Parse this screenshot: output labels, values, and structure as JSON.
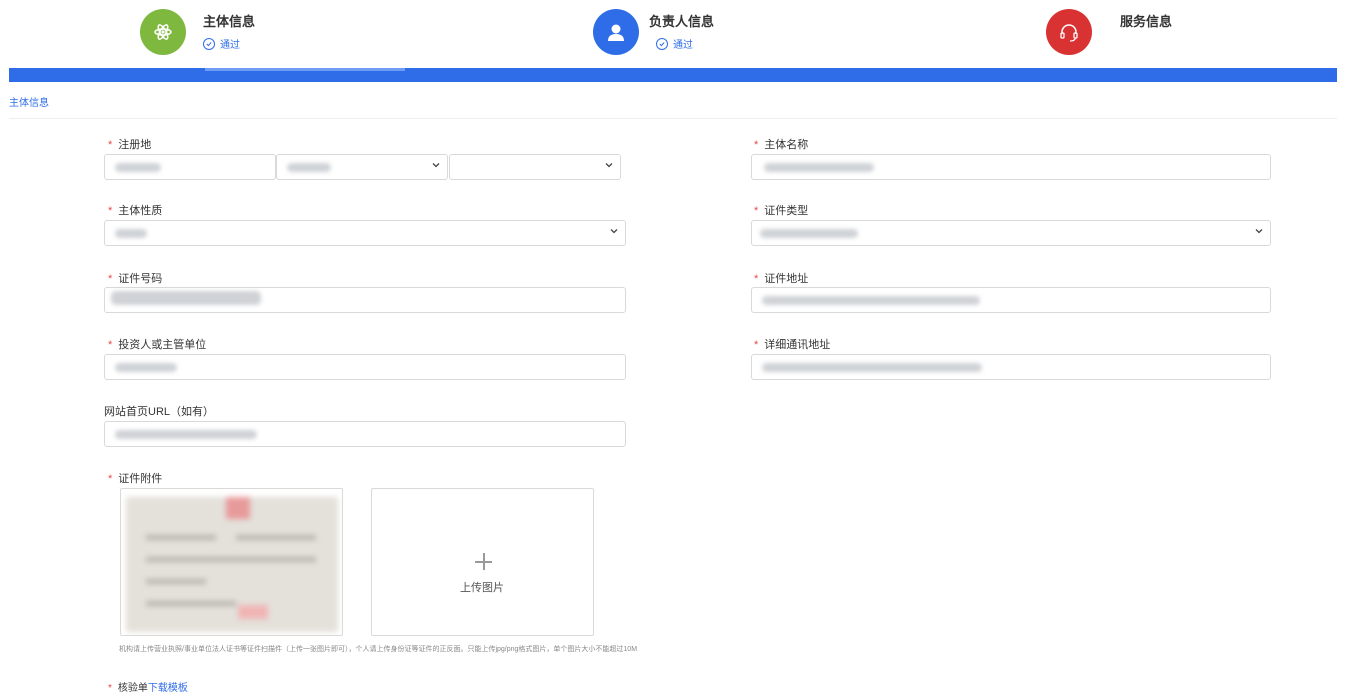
{
  "steps": [
    {
      "title": "主体信息",
      "status": "通过",
      "color": "#7fb83f",
      "icon": "atom-icon"
    },
    {
      "title": "负责人信息",
      "status": "通过",
      "color": "#2f6de8",
      "icon": "user-icon"
    },
    {
      "title": "服务信息",
      "status": "",
      "color": "#d83232",
      "icon": "headset-icon"
    }
  ],
  "section": {
    "title": "主体信息"
  },
  "fields": {
    "registration_place": {
      "label": "注册地",
      "required": true
    },
    "entity_name": {
      "label": "主体名称",
      "required": true
    },
    "entity_nature": {
      "label": "主体性质",
      "required": true
    },
    "cert_type": {
      "label": "证件类型",
      "required": true
    },
    "cert_number": {
      "label": "证件号码",
      "required": true
    },
    "cert_address": {
      "label": "证件地址",
      "required": true
    },
    "investor": {
      "label": "投资人或主管单位",
      "required": true
    },
    "contact_address": {
      "label": "详细通讯地址",
      "required": true
    },
    "website": {
      "label": "网站首页URL（如有）",
      "required": false
    },
    "attachment": {
      "label": "证件附件",
      "required": true
    }
  },
  "upload": {
    "label": "上传图片",
    "icon": "plus-icon"
  },
  "hint": "机构请上传营业执照/事业单位法人证书等证件扫描件（上传一张图片即可），个人请上传身份证等证件的正反面。只能上传jpg/png格式图片，单个图片大小不能超过10M",
  "next_field": {
    "label_prefix": "核验单",
    "link": "下载模板"
  },
  "required_mark": "*",
  "accent_color": "#2f6de8"
}
